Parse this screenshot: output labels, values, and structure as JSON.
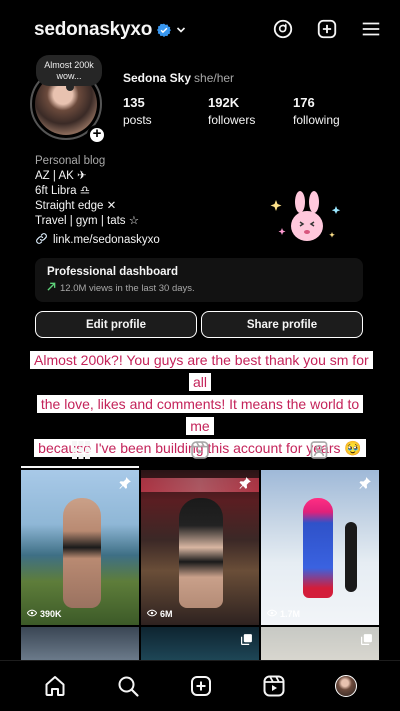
{
  "header": {
    "username": "sedonaskyxo",
    "verified": true,
    "icons": [
      "threads-icon",
      "create-icon",
      "menu-icon"
    ]
  },
  "profile": {
    "note": "Almost 200k wow...",
    "display_name": "Sedona Sky",
    "pronouns": "she/her",
    "stats": [
      {
        "value": "135",
        "label": "posts"
      },
      {
        "value": "192K",
        "label": "followers"
      },
      {
        "value": "176",
        "label": "following"
      }
    ]
  },
  "bio": {
    "category": "Personal blog",
    "lines": [
      "AZ | AK ✈︎",
      "6ft Libra ♎︎",
      "Straight edge ✕",
      "Travel | gym | tats ☆"
    ],
    "link": "link.me/sedonaskyxo"
  },
  "dashboard": {
    "title": "Professional dashboard",
    "subtitle": "12.0M views in the last 30 days."
  },
  "buttons": {
    "edit": "Edit profile",
    "share": "Share profile"
  },
  "caption": {
    "lines": [
      "Almost 200k?! You guys are the best thank you sm for all",
      "the love, likes and comments! It means the world to me",
      "because I've been building this account for years 🥹"
    ]
  },
  "tabs": [
    "grid-icon",
    "reels-icon",
    "tagged-icon"
  ],
  "posts": [
    {
      "views": "390K",
      "pinned": true
    },
    {
      "views": "6M",
      "pinned": true
    },
    {
      "views": "1.7M",
      "pinned": true
    },
    {
      "multi": false
    },
    {
      "multi": true
    },
    {
      "multi": true
    }
  ],
  "nav": [
    "home-icon",
    "search-icon",
    "create-icon",
    "reels-icon",
    "profile-avatar"
  ],
  "colors": {
    "background": "#000000",
    "caption_text": "#c4235a",
    "caption_background": "#ffffff",
    "verified": "#3897f0",
    "trend_arrow": "#5ed37a"
  }
}
